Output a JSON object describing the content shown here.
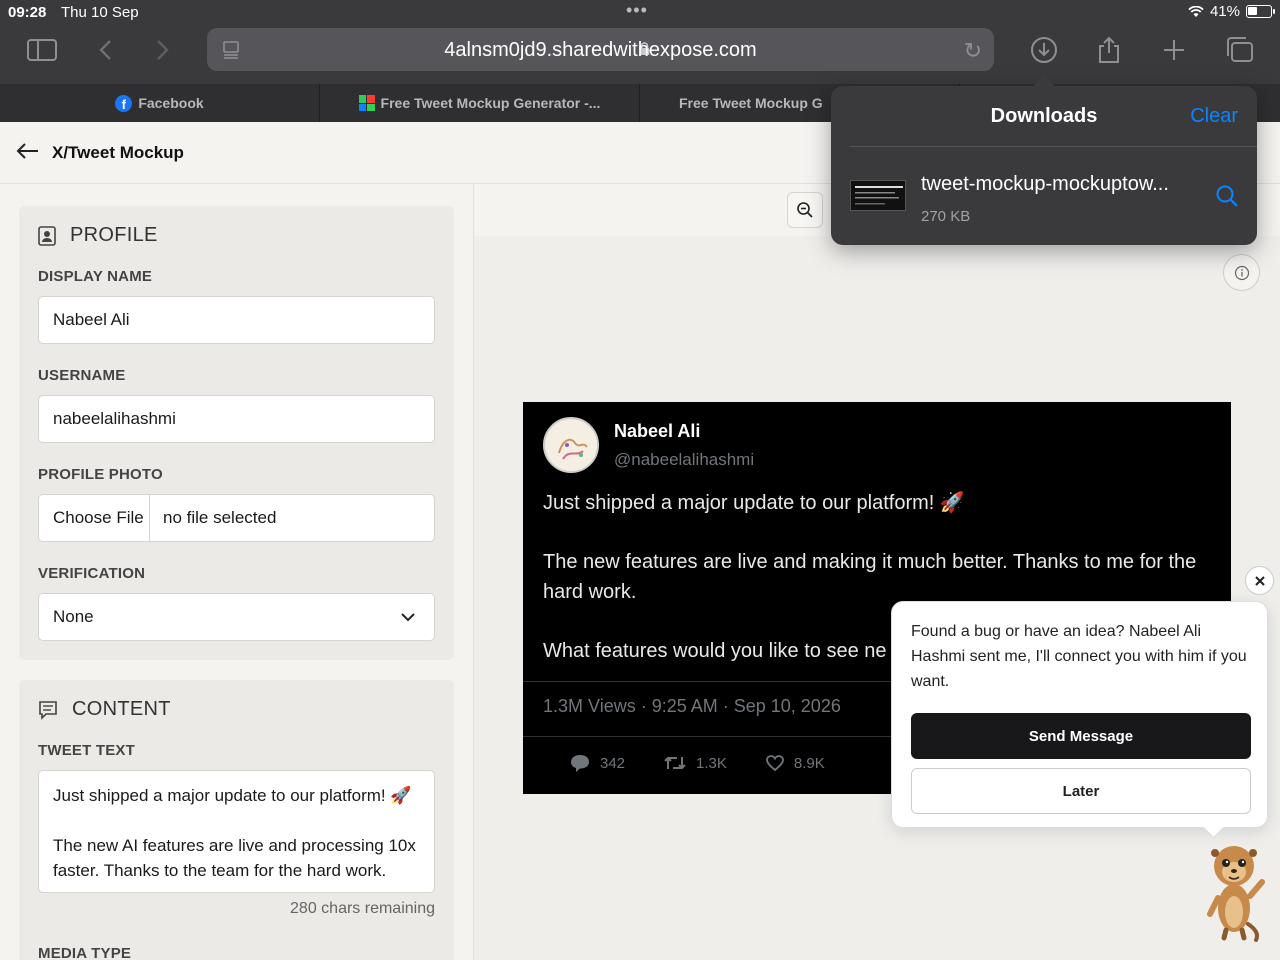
{
  "status_bar": {
    "time": "09:28",
    "date": "Thu 10 Sep",
    "battery": "41%"
  },
  "browser": {
    "url": "4alnsm0jd9.sharedwithexpose.com",
    "tabs": [
      {
        "label": "Facebook"
      },
      {
        "label": "Free Tweet Mockup Generator -..."
      },
      {
        "label": "Free Tweet Mockup G"
      }
    ]
  },
  "page": {
    "title": "X/Tweet Mockup"
  },
  "profile": {
    "section_title": "PROFILE",
    "display_name_label": "DISPLAY NAME",
    "display_name_value": "Nabeel Ali",
    "username_label": "USERNAME",
    "username_value": "nabeelalihashmi",
    "photo_label": "PROFILE PHOTO",
    "choose_file": "Choose File",
    "no_file": "no file selected",
    "verification_label": "VERIFICATION",
    "verification_value": "None"
  },
  "content": {
    "section_title": "CONTENT",
    "tweet_text_label": "TWEET TEXT",
    "tweet_text_line1": "Just shipped a major update to our platform! 🚀",
    "tweet_text_line2": "The new AI features are live and processing 10x faster. Thanks to the team for the hard work.",
    "chars_remaining": "280 chars remaining",
    "media_type_label": "MEDIA TYPE"
  },
  "tweet": {
    "name": "Nabeel Ali",
    "handle": "@nabeelalihashmi",
    "para1": "Just shipped a major update to our platform! 🚀",
    "para2": "The new features are live and making it much better. Thanks to me for the hard work.",
    "para3": "What features would you like to see ne",
    "meta": "1.3M Views · 9:25 AM · Sep 10, 2026",
    "replies": "342",
    "retweets": "1.3K",
    "likes": "8.9K"
  },
  "downloads": {
    "title": "Downloads",
    "clear": "Clear",
    "file_name": "tweet-mockup-mockuptow...",
    "file_size": "270 KB"
  },
  "feedback": {
    "message": "Found a bug or have an idea? Nabeel Ali Hashmi sent me, I'll connect you with him if you want.",
    "send_label": "Send Message",
    "later_label": "Later"
  },
  "colors": {
    "accent_blue": "#0a84ff",
    "tweet_bg": "#000000",
    "dark_button": "#18181b"
  }
}
